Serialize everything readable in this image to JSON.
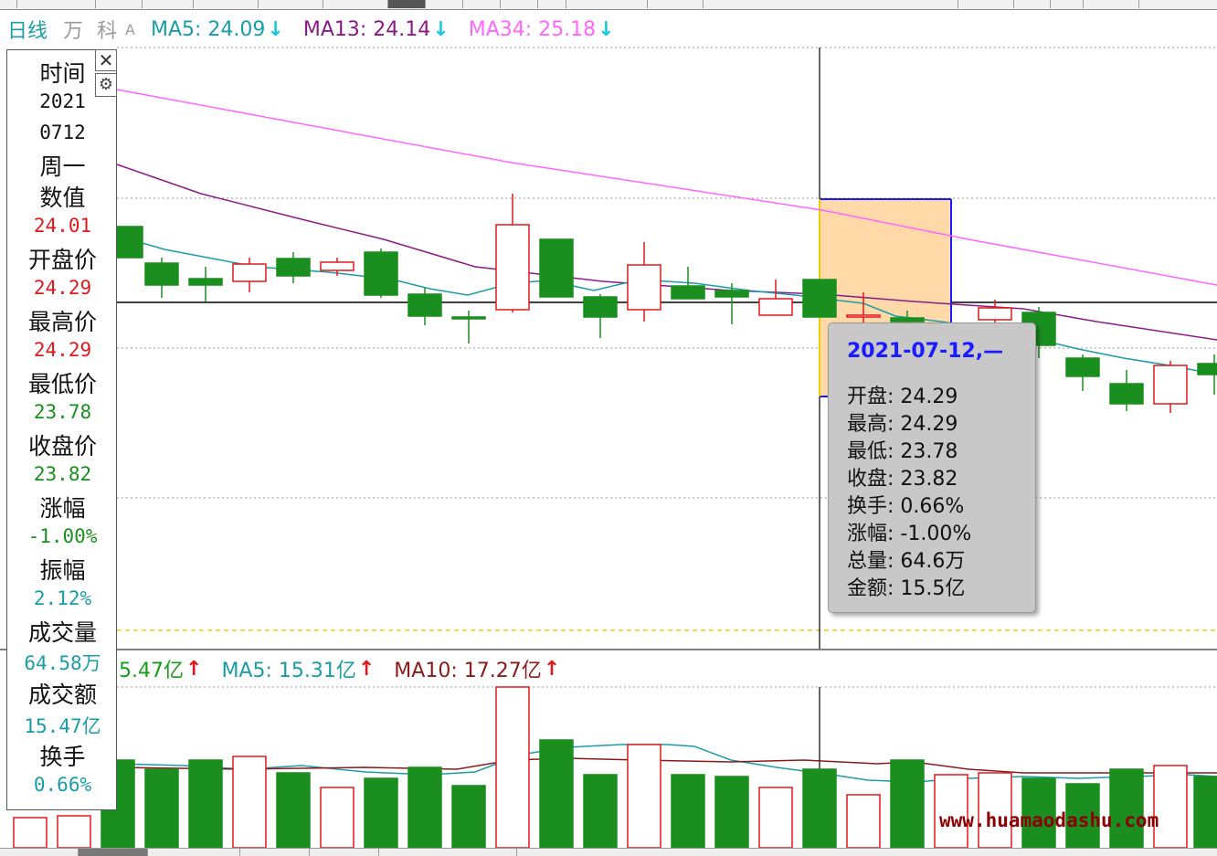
{
  "period_label": "日线",
  "flags": [
    "万",
    "科",
    "A"
  ],
  "ma_indicators": [
    {
      "label": "MA5: 24.09",
      "color": "#1a9ca8"
    },
    {
      "label": "MA13: 24.14",
      "color": "#8b1a89"
    },
    {
      "label": "MA34: 25.18",
      "color": "#ff66ff"
    }
  ],
  "volume_indicators": [
    {
      "label": "5.47亿",
      "color": "#1a9d1a"
    },
    {
      "label": "MA5: 15.31亿",
      "color": "#1a9ca8"
    },
    {
      "label": "MA10: 17.27亿",
      "color": "#8b1a1a"
    }
  ],
  "info_panel": {
    "time_label": "时间",
    "year": "2021",
    "date": "0712",
    "weekday": "周一",
    "value_label": "数值",
    "value": "24.01",
    "open_label": "开盘价",
    "open": "24.29",
    "high_label": "最高价",
    "high": "24.29",
    "low_label": "最低价",
    "low": "23.78",
    "close_label": "收盘价",
    "close": "23.82",
    "change_label": "涨幅",
    "change": "-1.00%",
    "amplitude_label": "振幅",
    "amplitude": "2.12%",
    "volume_label": "成交量",
    "volume": "64.58万",
    "amount_label": "成交额",
    "amount": "15.47亿",
    "turnover_label": "换手",
    "turnover": "0.66%"
  },
  "tooltip": {
    "date": "2021-07-12,—",
    "rows": [
      "开盘: 24.29",
      "最高: 24.29",
      "最低: 23.78",
      "收盘: 23.82",
      "换手: 0.66%",
      "涨幅: -1.00%",
      "总量: 64.6万",
      "金额: 15.5亿"
    ]
  },
  "watermark": "www.huamaodashu.com",
  "colors": {
    "up": "#e0191c",
    "down": "#1a8f1f",
    "ma5": "#1a9ca8",
    "ma13": "#8b1a89",
    "ma34": "#ff66ff",
    "highlight": "#ffd9a8",
    "tooltip_date": "#1a1aff"
  },
  "close_icon": "close-icon",
  "settings_icon": "gear-icon"
}
